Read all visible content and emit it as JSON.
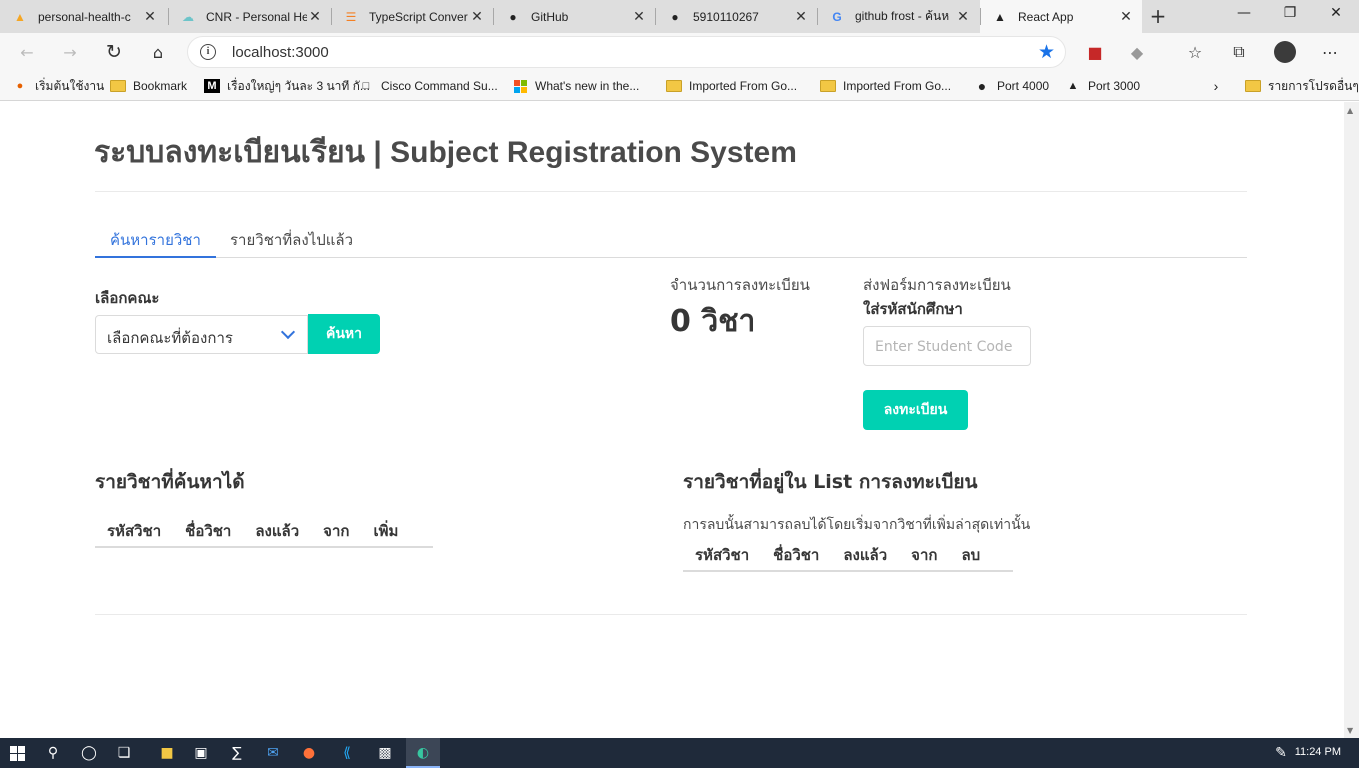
{
  "browser": {
    "tabs": [
      {
        "title": "personal-health-c",
        "icon": "firebase-icon",
        "color": "#f5a623"
      },
      {
        "title": "CNR - Personal He",
        "icon": "cloud-icon",
        "color": "#6dc4c9"
      },
      {
        "title": "TypeScript Conver",
        "icon": "stackoverflow-icon",
        "color": "#f48024"
      },
      {
        "title": "GitHub",
        "icon": "github-icon",
        "color": "#111111"
      },
      {
        "title": "5910110267",
        "icon": "github-icon",
        "color": "#111111"
      },
      {
        "title": "github frost - ค้นห",
        "icon": "google-icon",
        "color": "#4285f4"
      },
      {
        "title": "React App",
        "icon": "triangle-icon",
        "color": "#111111",
        "active": true
      }
    ],
    "url": "localhost:3000",
    "bookmarks": [
      {
        "label": "เริ่มต้นใช้งาน",
        "icon": "firefox-icon"
      },
      {
        "label": "Bookmark",
        "icon": "folder-icon"
      },
      {
        "label": "เรื่องใหญ่ๆ วันละ 3 นาที กั...",
        "icon": "medium-icon"
      },
      {
        "label": "Cisco Command Su...",
        "icon": "page-icon"
      },
      {
        "label": "What's new in the...",
        "icon": "microsoft-icon"
      },
      {
        "label": "Imported From Go...",
        "icon": "folder-icon"
      },
      {
        "label": "Imported From Go...",
        "icon": "folder-icon"
      },
      {
        "label": "Port 4000",
        "icon": "circle-icon"
      },
      {
        "label": "Port 3000",
        "icon": "triangle-icon"
      },
      {
        "label": "รายการโปรดอื่นๆ",
        "icon": "folder-icon"
      }
    ]
  },
  "app": {
    "title": "ระบบลงทะเบียนเรียน | Subject Registration System",
    "tabs": [
      "ค้นหารายวิชา",
      "รายวิชาที่ลงไปแล้ว"
    ],
    "faculty_label": "เลือกคณะ",
    "faculty_select": "เลือกคณะที่ต้องการ",
    "search_button": "ค้นหา",
    "count_label": "จำนวนการลงทะเบียน",
    "count_value": "0 วิชา",
    "form_label": "ส่งฟอร์มการลงทะเบียน",
    "student_code_label": "ใส่รหัสนักศึกษา",
    "student_code_placeholder": "Enter Student Code",
    "register_button": "ลงทะเบียน",
    "search_results": {
      "title": "รายวิชาที่ค้นหาได้",
      "columns": [
        "รหัสวิชา",
        "ชื่อวิชา",
        "ลงแล้ว",
        "จาก",
        "เพิ่ม"
      ]
    },
    "register_list": {
      "title": "รายวิชาที่อยู่ใน List การลงทะเบียน",
      "note": "การลบนั้นสามารถลบได้โดยเริ่มจากวิชาที่เพิ่มล่าสุดเท่านั้น",
      "columns": [
        "รหัสวิชา",
        "ชื่อวิชา",
        "ลงแล้ว",
        "จาก",
        "ลบ"
      ]
    },
    "colors": {
      "primary": "#00d1b2",
      "link": "#3273dc"
    }
  },
  "taskbar": {
    "time": "11:24 PM"
  }
}
